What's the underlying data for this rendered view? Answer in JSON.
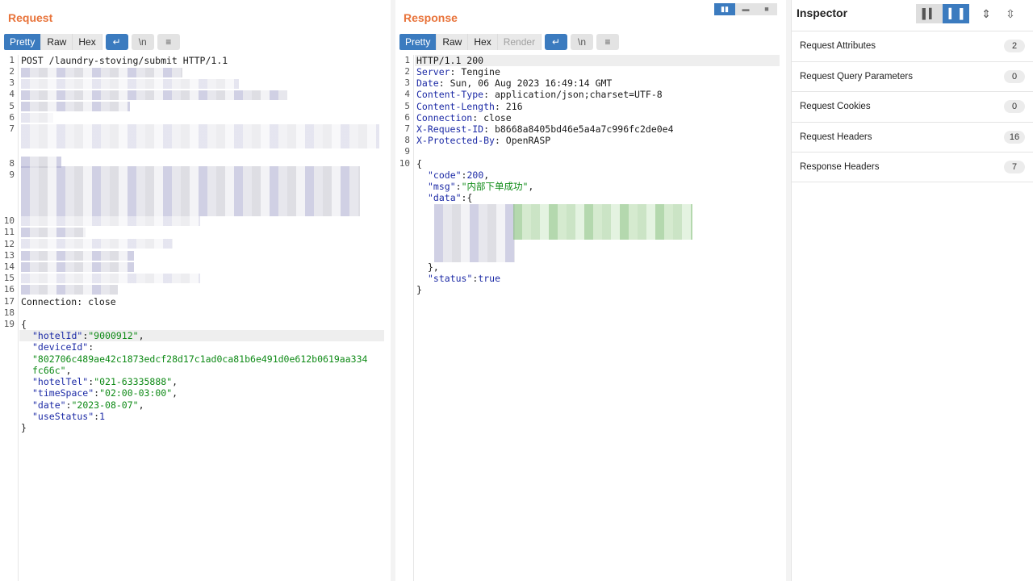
{
  "request": {
    "title": "Request",
    "tabs": [
      "Pretty",
      "Raw",
      "Hex"
    ],
    "tools": [
      "↵",
      "\\n",
      "≡"
    ],
    "first_line": "POST /laundry-stoving/submit HTTP/1.1",
    "line_17": "Connection: close",
    "line_numbers": [
      "1",
      "2",
      "3",
      "4",
      "5",
      "6",
      "7",
      "8",
      "9",
      "10",
      "11",
      "12",
      "13",
      "14",
      "15",
      "16",
      "17",
      "18",
      "19"
    ],
    "body": {
      "open": "{",
      "k1": "\"hotelId\"",
      "v1": "\"9000912\"",
      "k2": "\"deviceId\"",
      "v2a": "\"802706c489ae42c1873edcf28d17c1ad0ca81b6e491d0e612b0619aa334",
      "v2b": "fc66c\"",
      "k3": "\"hotelTel\"",
      "v3": "\"021-63335888\"",
      "k4": "\"timeSpace\"",
      "v4": "\"02:00-03:00\"",
      "k5": "\"date\"",
      "v5": "\"2023-08-07\"",
      "k6": "\"useStatus\"",
      "v6": "1",
      "close": "}"
    }
  },
  "response": {
    "title": "Response",
    "tabs": [
      "Pretty",
      "Raw",
      "Hex",
      "Render"
    ],
    "tools": [
      "↵",
      "\\n",
      "≡"
    ],
    "line_numbers": [
      "1",
      "2",
      "3",
      "4",
      "5",
      "6",
      "7",
      "8",
      "9",
      "10"
    ],
    "headers": [
      {
        "plain": "HTTP/1.1 200"
      },
      {
        "key": "Server",
        "val": "Tengine"
      },
      {
        "key": "Date",
        "val": "Sun, 06 Aug 2023 16:49:14 GMT"
      },
      {
        "key": "Content-Type",
        "val": "application/json;charset=UTF-8"
      },
      {
        "key": "Content-Length",
        "val": "216"
      },
      {
        "key": "Connection",
        "val": "close"
      },
      {
        "key": "X-Request-ID",
        "val": "b8668a8405bd46e5a4a7c996fc2de0e4"
      },
      {
        "key": "X-Protected-By",
        "val": "OpenRASP"
      }
    ],
    "body": {
      "open": "{",
      "code_key": "\"code\"",
      "code_val": "200",
      "msg_key": "\"msg\"",
      "msg_val": "\"内部下单成功\"",
      "data_key": "\"data\"",
      "data_open": "{",
      "data_close": "},",
      "status_key": "\"status\"",
      "status_val": "true",
      "close": "}"
    }
  },
  "inspector": {
    "title": "Inspector",
    "rows": [
      {
        "label": "Request Attributes",
        "count": "2"
      },
      {
        "label": "Request Query Parameters",
        "count": "0"
      },
      {
        "label": "Request Cookies",
        "count": "0"
      },
      {
        "label": "Request Headers",
        "count": "16"
      },
      {
        "label": "Response Headers",
        "count": "7"
      }
    ]
  },
  "colors": {
    "accent": "#3b7bbf",
    "title": "#e8733a",
    "string": "#0e8a16",
    "key": "#1d2ba6"
  }
}
